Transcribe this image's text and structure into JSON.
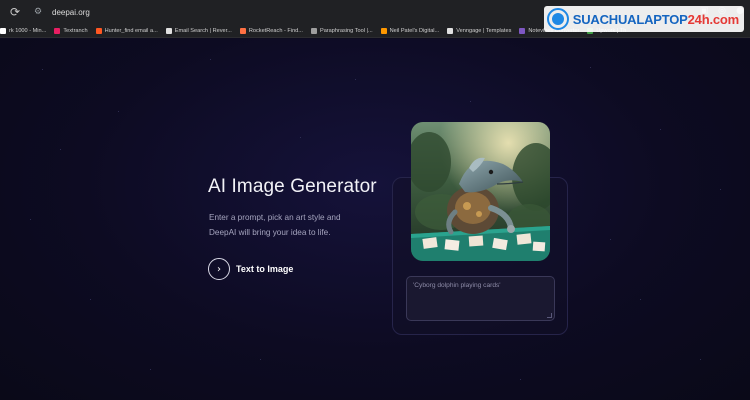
{
  "browser": {
    "url": "deepai.org",
    "bookmarks": [
      {
        "label": "rk 1000 - Min...",
        "color": "#ffffff"
      },
      {
        "label": "Textranch",
        "color": "#e91e63"
      },
      {
        "label": "Hunter_find email a...",
        "color": "#ff5722"
      },
      {
        "label": "Email Search | Rever...",
        "color": "#e0e0e0"
      },
      {
        "label": "RocketReach - Find...",
        "color": "#ff7043"
      },
      {
        "label": "Paraphrasing Tool |...",
        "color": "#9e9e9e"
      },
      {
        "label": "Neil Patel's Digital...",
        "color": "#ff9800"
      },
      {
        "label": "Venngage | Templates",
        "color": "#e0e0e0"
      },
      {
        "label": "Notevibes Converter",
        "color": "#7e57c2"
      },
      {
        "label": "Upwork | Th",
        "color": "#43a047"
      }
    ]
  },
  "watermark": {
    "part1": "SUACHUALAPTOP",
    "part2": "24h.com"
  },
  "hero": {
    "title": "AI Image Generator",
    "description": "Enter a prompt, pick an art style and DeepAI will bring your idea to life.",
    "cta_label": "Text to Image"
  },
  "generator": {
    "prompt_placeholder": "'Cyborg dolphin playing cards'"
  },
  "colors": {
    "background": "#0d0b20",
    "accent": "#ffffff"
  },
  "icons": {
    "reload": "reload-icon",
    "site_info": "site-info-icon",
    "cta": "chevron-right-icon"
  }
}
